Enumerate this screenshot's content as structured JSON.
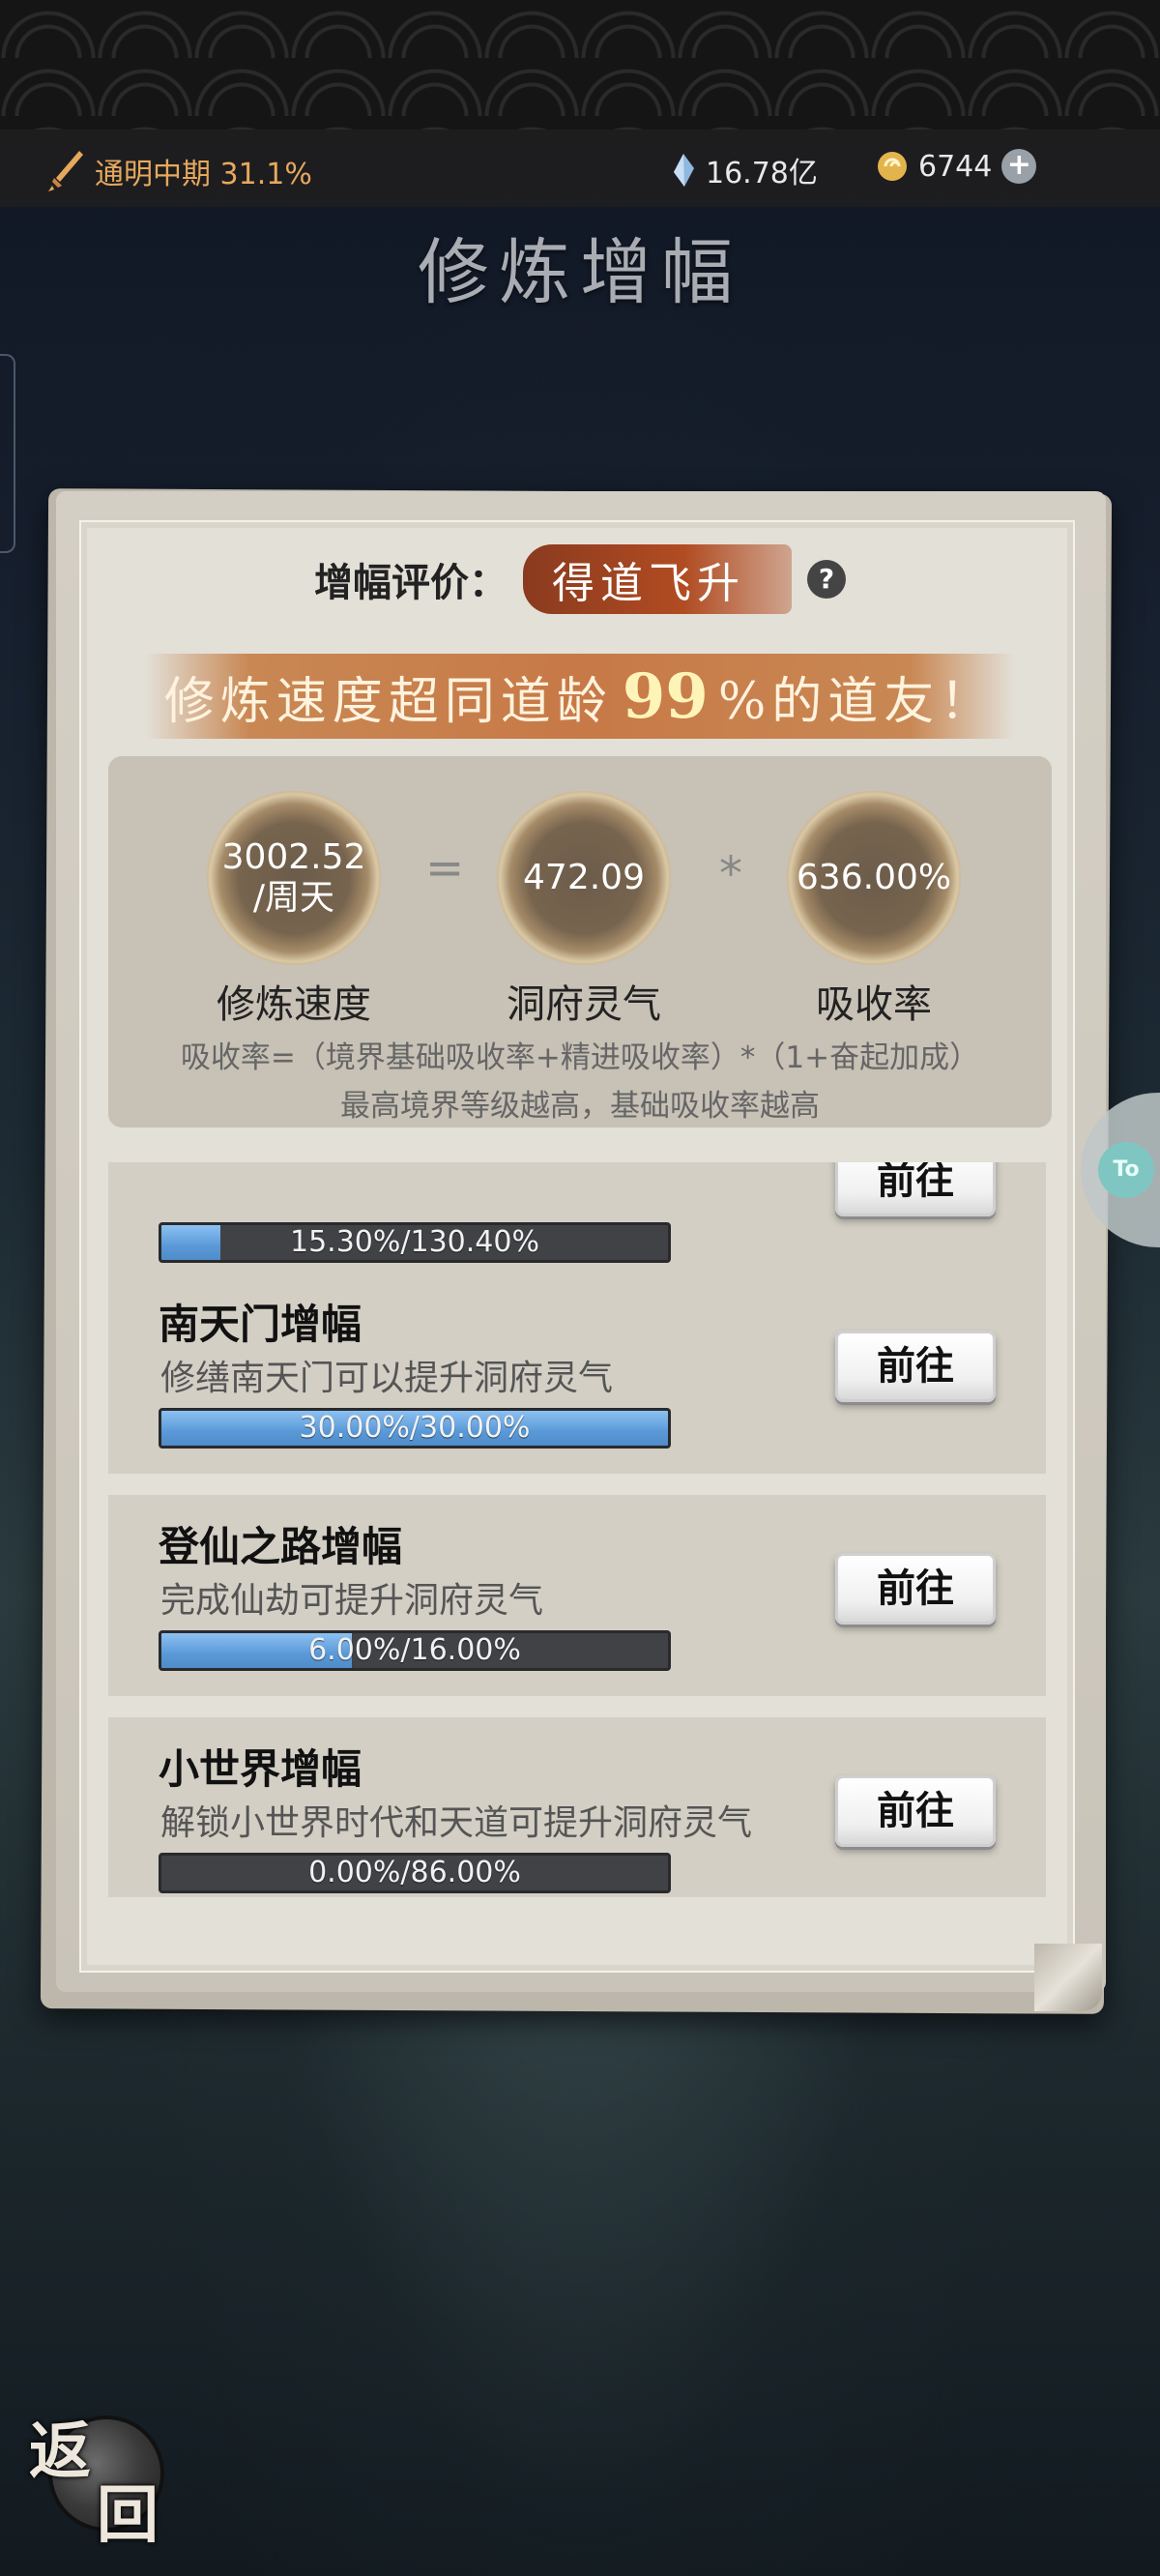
{
  "header": {
    "realm_label": "通明中期 31.1%",
    "spirit_stones": "16.78亿",
    "coins": "6744",
    "icons": {
      "realm": "sword-icon",
      "stones": "crystal-icon",
      "coins": "coin-icon",
      "add": "plus-icon"
    }
  },
  "page_title": "修炼增幅",
  "rating": {
    "label": "增幅评价：",
    "value": "得道飞升",
    "help": "?"
  },
  "banner": {
    "prefix": "修炼速度超同道龄",
    "percent": "99",
    "suffix": "%的道友！"
  },
  "formula": {
    "speed_value_line1": "3002.52",
    "speed_value_line2": "/周天",
    "speed_caption": "修炼速度",
    "equals": "=",
    "aura_value": "472.09",
    "aura_caption": "洞府灵气",
    "times": "*",
    "rate_value": "636.00%",
    "rate_caption": "吸收率",
    "explanation": "吸收率=（境界基础吸收率+精进吸收率）*（1+奋起加成）",
    "note": "最高境界等级越高，基础吸收率越高"
  },
  "rows": [
    {
      "title": "",
      "desc": "",
      "button": "前往",
      "progress_text": "15.30%/130.40%",
      "progress": 0.117
    },
    {
      "title": "南天门增幅",
      "desc": "修缮南天门可以提升洞府灵气",
      "button": "前往",
      "progress_text": "30.00%/30.00%",
      "progress": 1.0
    },
    {
      "title": "登仙之路增幅",
      "desc": "完成仙劫可提升洞府灵气",
      "button": "前往",
      "progress_text": "6.00%/16.00%",
      "progress": 0.375
    },
    {
      "title": "小世界增幅",
      "desc": "解锁小世界时代和天道可提升洞府灵气",
      "button": "前往",
      "progress_text": "0.00%/86.00%",
      "progress": 0.0
    }
  ],
  "side_badge": "To",
  "back": {
    "char1": "返",
    "char2": "回"
  },
  "colors": {
    "accent": "#e6a85d",
    "badge": "#b14c22",
    "bar_fill": "#5a99d8"
  }
}
